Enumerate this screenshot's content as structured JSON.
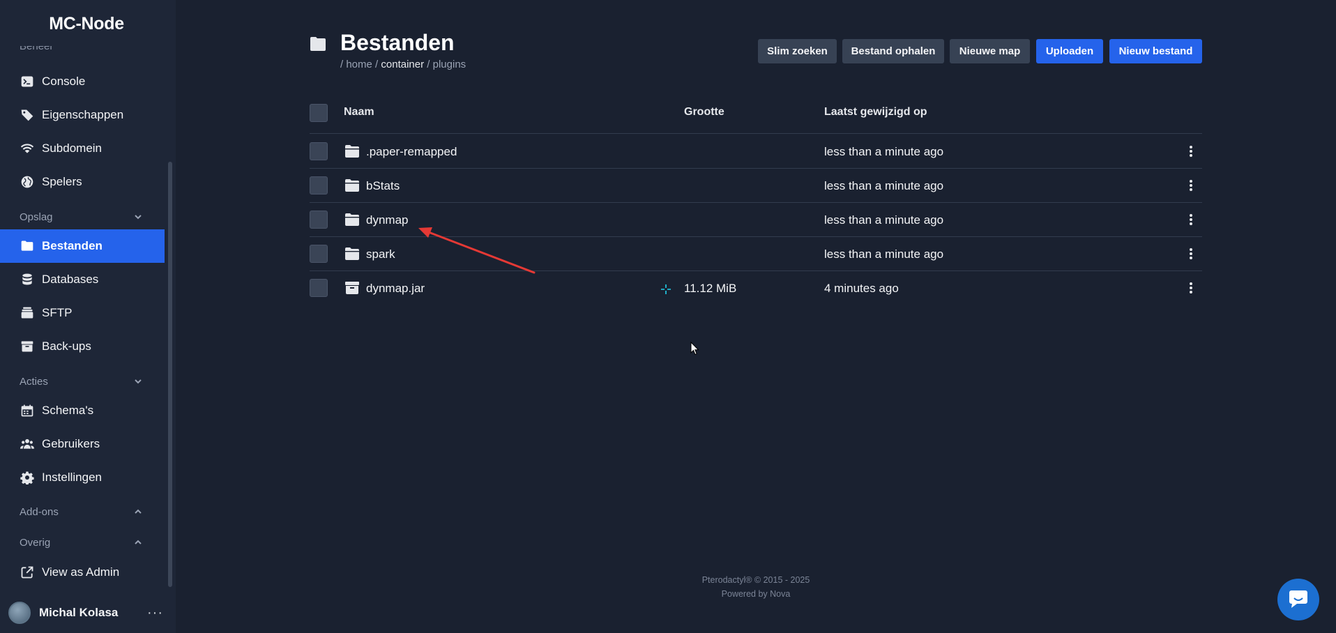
{
  "brand": "MC-Node",
  "sidebar": {
    "cut_heading": "Beheer",
    "items_top": [
      {
        "label": "Console",
        "icon": "terminal-icon"
      },
      {
        "label": "Eigenschappen",
        "icon": "tag-icon"
      },
      {
        "label": "Subdomein",
        "icon": "wifi-icon"
      },
      {
        "label": "Spelers",
        "icon": "globe-icon"
      }
    ],
    "section_opslag": "Opslag",
    "items_opslag": [
      {
        "label": "Bestanden",
        "icon": "folder-icon",
        "active": true
      },
      {
        "label": "Databases",
        "icon": "database-icon"
      },
      {
        "label": "SFTP",
        "icon": "stack-icon"
      },
      {
        "label": "Back-ups",
        "icon": "archive-icon"
      }
    ],
    "section_acties": "Acties",
    "items_acties": [
      {
        "label": "Schema's",
        "icon": "calendar-icon"
      },
      {
        "label": "Gebruikers",
        "icon": "users-icon"
      },
      {
        "label": "Instellingen",
        "icon": "gear-icon"
      }
    ],
    "section_addons": "Add-ons",
    "section_overig": "Overig",
    "items_overig": [
      {
        "label": "View as Admin",
        "icon": "external-link-icon"
      }
    ],
    "user_name": "Michal Kolasa",
    "user_more": "···"
  },
  "header": {
    "title": "Bestanden",
    "breadcrumb": {
      "sep": "/",
      "parts": [
        "home",
        "container",
        "plugins"
      ]
    }
  },
  "toolbar": {
    "smart_search": "Slim zoeken",
    "fetch_file": "Bestand ophalen",
    "new_folder": "Nieuwe map",
    "upload": "Uploaden",
    "new_file": "Nieuw bestand"
  },
  "table": {
    "columns": {
      "name": "Naam",
      "size": "Grootte",
      "modified": "Laatst gewijzigd op"
    },
    "rows": [
      {
        "name": ".paper-remapped",
        "type": "folder",
        "size": "",
        "modified": "less than a minute ago"
      },
      {
        "name": "bStats",
        "type": "folder",
        "size": "",
        "modified": "less than a minute ago"
      },
      {
        "name": "dynmap",
        "type": "folder",
        "size": "",
        "modified": "less than a minute ago"
      },
      {
        "name": "spark",
        "type": "folder",
        "size": "",
        "modified": "less than a minute ago"
      },
      {
        "name": "dynmap.jar",
        "type": "archive",
        "size": "11.12 MiB",
        "modified": "4 minutes ago"
      }
    ]
  },
  "footer": {
    "line1": "Pterodactyl® © 2015 - 2025",
    "line2": "Powered by Nova"
  },
  "colors": {
    "accent": "#2563eb",
    "annotation_arrow": "#e53935",
    "chat": "#1c6fd1"
  }
}
